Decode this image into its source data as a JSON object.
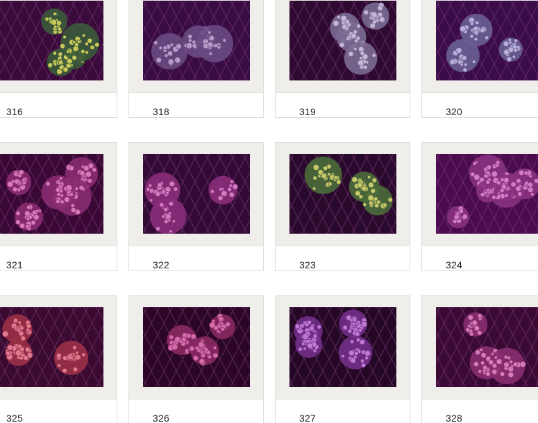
{
  "gallery": {
    "items": [
      {
        "number": "316",
        "polyp_color": "#c9c75a",
        "center_color": "#3a5a3a",
        "tank_color": "#3a0a3a"
      },
      {
        "number": "318",
        "polyp_color": "#b89ac8",
        "center_color": "#6a4a82",
        "tank_color": "#3a0c44"
      },
      {
        "number": "319",
        "polyp_color": "#c4b6d4",
        "center_color": "#7a6a92",
        "tank_color": "#2e0a30"
      },
      {
        "number": "320",
        "polyp_color": "#b8b0d8",
        "center_color": "#6a5e92",
        "tank_color": "#3a0c48"
      },
      {
        "number": "321",
        "polyp_color": "#d87ab8",
        "center_color": "#8a2c72",
        "tank_color": "#3a0834"
      },
      {
        "number": "322",
        "polyp_color": "#d27cc0",
        "center_color": "#8a2e7a",
        "tank_color": "#330a36"
      },
      {
        "number": "323",
        "polyp_color": "#c8c86a",
        "center_color": "#4a6a3a",
        "tank_color": "#2a0a2c"
      },
      {
        "number": "324",
        "polyp_color": "#d27ec4",
        "center_color": "#8a3280",
        "tank_color": "#4a0c4e"
      },
      {
        "number": "325",
        "polyp_color": "#e07a92",
        "center_color": "#9a3046",
        "tank_color": "#3a0a30"
      },
      {
        "number": "326",
        "polyp_color": "#d46eaa",
        "center_color": "#8a2a64",
        "tank_color": "#2c0626"
      },
      {
        "number": "327",
        "polyp_color": "#c07ad2",
        "center_color": "#72308a",
        "tank_color": "#240826"
      },
      {
        "number": "328",
        "polyp_color": "#d67cb8",
        "center_color": "#8a2e70",
        "tank_color": "#3a0a34"
      }
    ]
  }
}
